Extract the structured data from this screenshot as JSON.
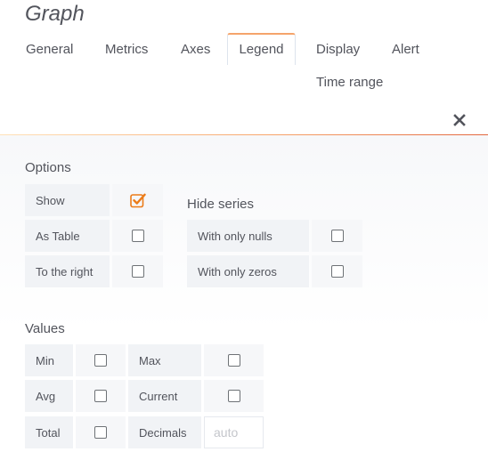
{
  "panel": {
    "title": "Graph"
  },
  "tabs": [
    {
      "label": "General"
    },
    {
      "label": "Metrics"
    },
    {
      "label": "Axes"
    },
    {
      "label": "Legend",
      "active": true
    },
    {
      "label": "Display"
    },
    {
      "label": "Alert"
    },
    {
      "label": "Time range"
    }
  ],
  "colors": {
    "accent": "#f5a46b",
    "check": "#eb7b18"
  },
  "options": {
    "title": "Options",
    "show": {
      "label": "Show",
      "checked": true
    },
    "as_table": {
      "label": "As Table",
      "checked": false
    },
    "to_the_right": {
      "label": "To the right",
      "checked": false
    }
  },
  "hide_series": {
    "title": "Hide series",
    "with_only_nulls": {
      "label": "With only nulls",
      "checked": false
    },
    "with_only_zeros": {
      "label": "With only zeros",
      "checked": false
    }
  },
  "values": {
    "title": "Values",
    "min": {
      "label": "Min",
      "checked": false
    },
    "max": {
      "label": "Max",
      "checked": false
    },
    "avg": {
      "label": "Avg",
      "checked": false
    },
    "current": {
      "label": "Current",
      "checked": false
    },
    "total": {
      "label": "Total",
      "checked": false
    },
    "decimals": {
      "label": "Decimals",
      "value": "",
      "placeholder": "auto"
    }
  }
}
